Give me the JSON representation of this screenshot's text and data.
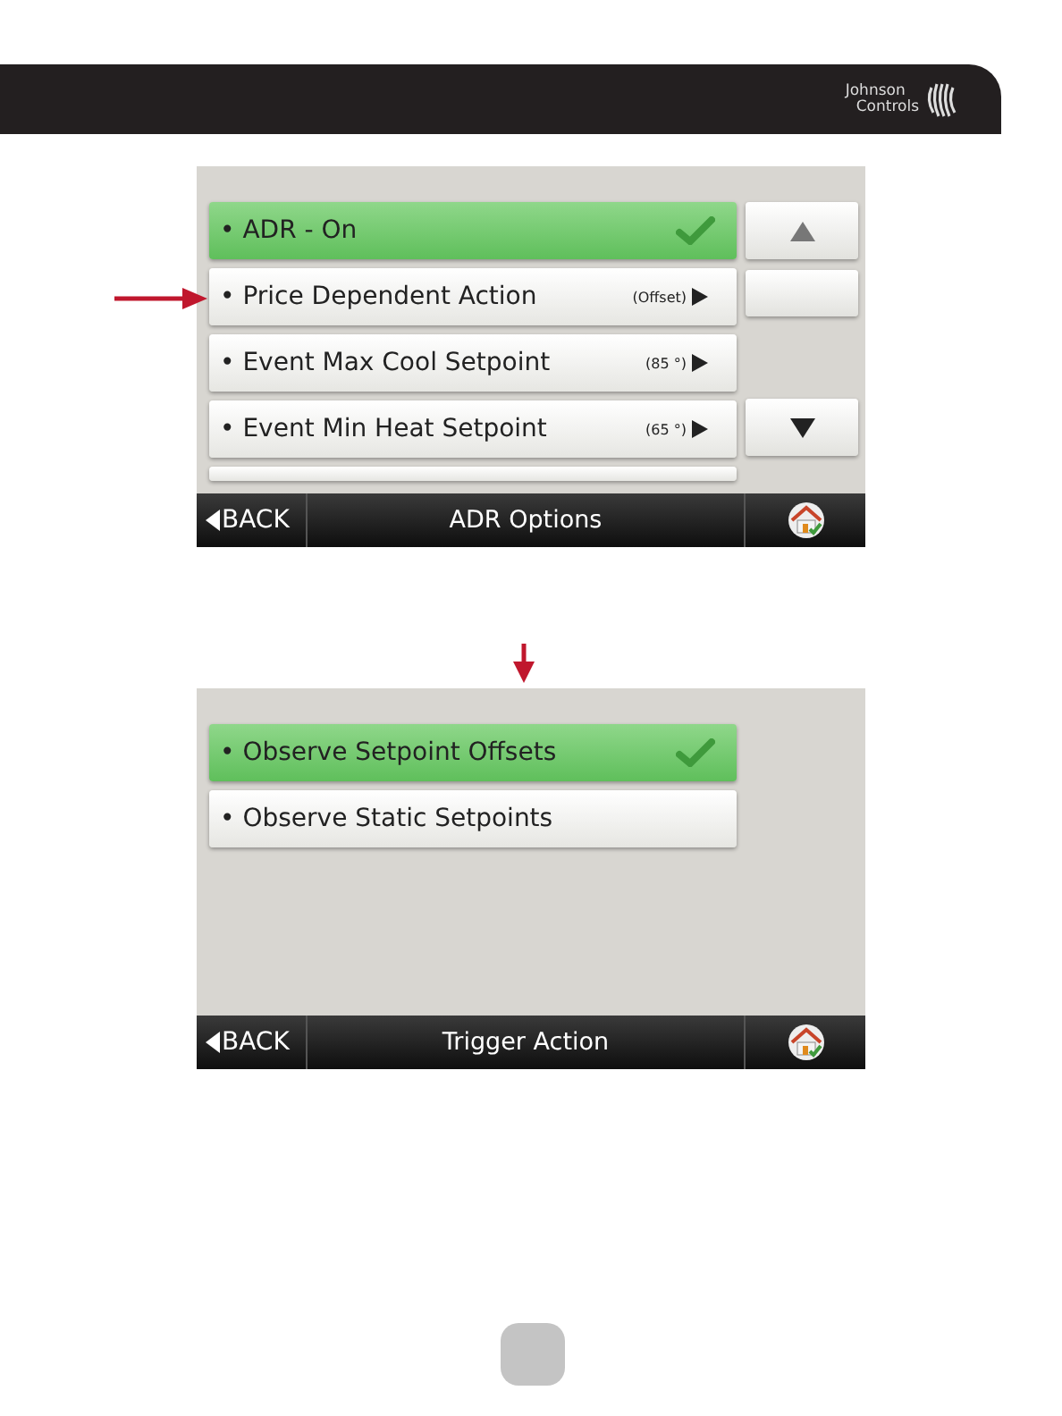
{
  "header": {
    "logo_lines": [
      "Johnson",
      "Controls"
    ]
  },
  "screens": [
    {
      "title": "ADR Options",
      "back": "BACK",
      "callout": {
        "kind": "left"
      },
      "items": [
        {
          "kind": "option",
          "label": "• ADR - On",
          "selected": true
        },
        {
          "kind": "submenu",
          "label": "• Price Dependent Action",
          "value": "(Offset)",
          "selected": false
        },
        {
          "kind": "submenu",
          "label": "• Event Max Cool Setpoint",
          "value": "(85 °)",
          "selected": false
        },
        {
          "kind": "submenu",
          "label": "• Event Min Heat Setpoint",
          "value": "(65 °)",
          "selected": false
        },
        {
          "kind": "partial"
        }
      ],
      "scroll": [
        {
          "kind": "up"
        },
        {
          "kind": "blank"
        },
        {
          "kind": "down"
        }
      ]
    },
    {
      "title": "Trigger Action",
      "back": "BACK",
      "callout": {
        "kind": "top"
      },
      "items": [
        {
          "kind": "option",
          "label": "• Observe Setpoint Offsets",
          "selected": true
        },
        {
          "kind": "option",
          "label": "• Observe Static Setpoints",
          "selected": false
        }
      ]
    }
  ]
}
